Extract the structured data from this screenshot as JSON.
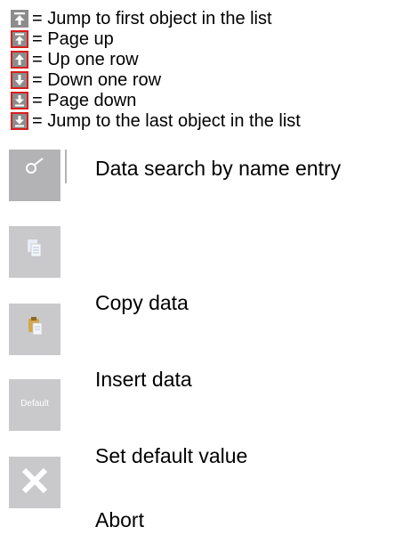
{
  "navigation_legend": [
    {
      "icon": "jump-to-first-icon",
      "framed": false,
      "text": "= Jump to first object in the list"
    },
    {
      "icon": "page-up-icon",
      "framed": true,
      "text": "= Page up"
    },
    {
      "icon": "up-one-row-icon",
      "framed": true,
      "text": "= Up one row"
    },
    {
      "icon": "down-one-row-icon",
      "framed": true,
      "text": "= Down one row"
    },
    {
      "icon": "page-down-icon",
      "framed": true,
      "text": "= Page down"
    },
    {
      "icon": "jump-to-last-icon",
      "framed": true,
      "text": "= Jump to the last object in the list"
    }
  ],
  "button_legend": [
    {
      "icon": "search-icon",
      "text": "Data search by name entry"
    },
    {
      "icon": "copy-icon",
      "text": "Copy data"
    },
    {
      "icon": "paste-icon",
      "text": "Insert data"
    },
    {
      "icon": "default-icon",
      "icon_label": "Default",
      "text": "Set default value"
    },
    {
      "icon": "abort-icon",
      "text": "Abort"
    }
  ],
  "colors": {
    "nav_icon_bg": "#8c8c8c",
    "nav_icon_frame": "#d81e1e",
    "button_bg": "#c9c9cc",
    "icon_fg": "#ffffff"
  }
}
